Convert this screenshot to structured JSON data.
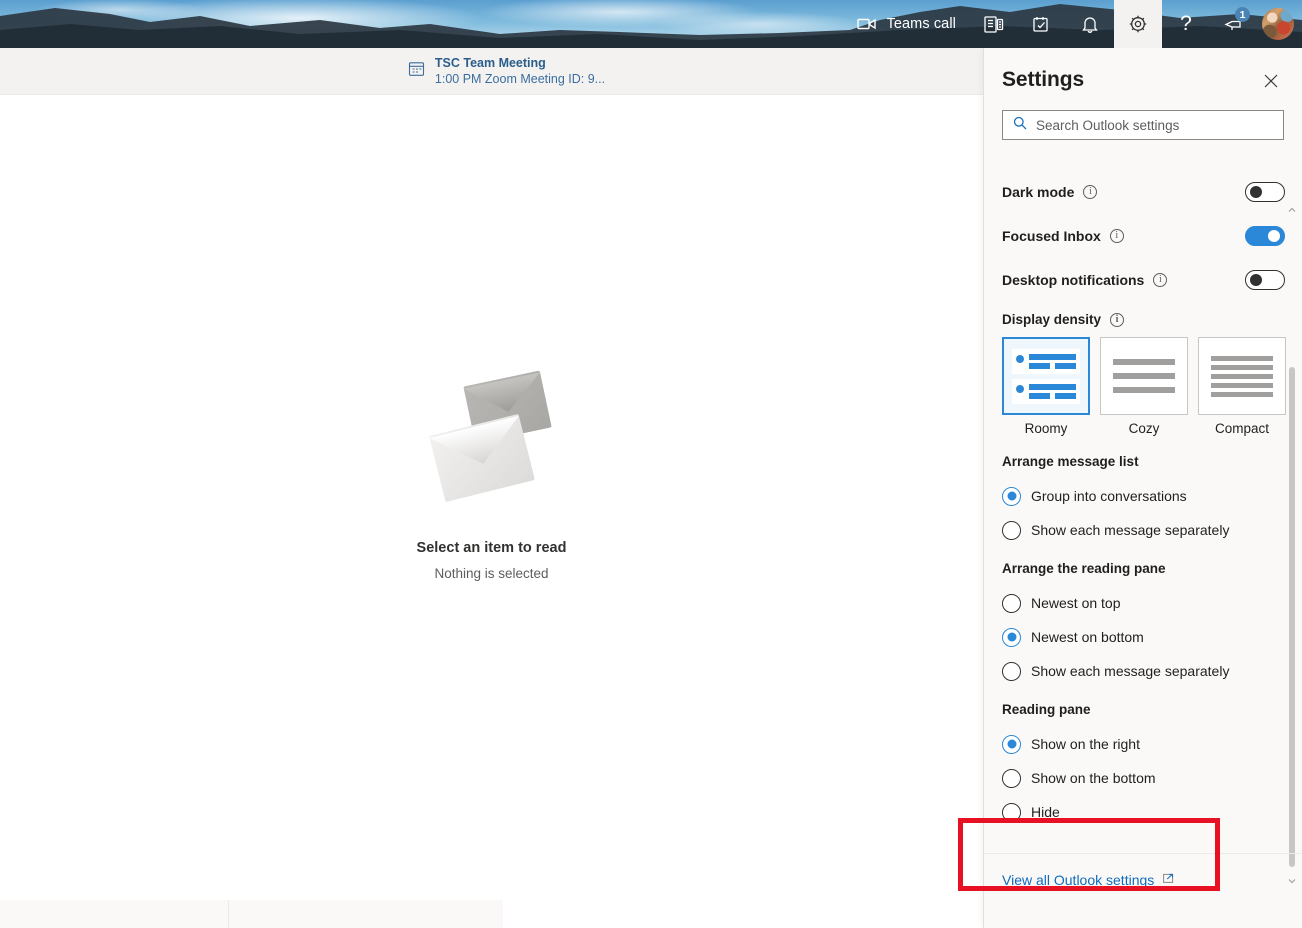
{
  "topbar": {
    "teams_call_label": "Teams call",
    "icons": [
      {
        "name": "video-camera-icon"
      },
      {
        "name": "office-apps-icon"
      },
      {
        "name": "tasks-icon"
      },
      {
        "name": "notifications-bell-icon"
      },
      {
        "name": "settings-gear-icon"
      },
      {
        "name": "help-question-icon"
      },
      {
        "name": "feedback-icon"
      },
      {
        "name": "account-avatar"
      }
    ],
    "feedback_badge": "1",
    "help_label": "?",
    "accent_color": "#4b88bb",
    "active_bg": "#f3f2f1"
  },
  "meeting_reminder": {
    "icon": "calendar-icon",
    "title": "TSC Team Meeting",
    "subtitle": "1:00 PM Zoom Meeting ID: 9...",
    "text_color": "#3b6e9e"
  },
  "reading_pane": {
    "empty_icon": "envelopes-icon",
    "empty_title": "Select an item to read",
    "empty_subtitle": "Nothing is selected"
  },
  "settings": {
    "title": "Settings",
    "close_icon": "close-icon",
    "search": {
      "icon": "search-icon",
      "placeholder": "Search Outlook settings",
      "value": ""
    },
    "toggles": [
      {
        "label": "Dark mode",
        "state": "off",
        "info_icon": "info-icon"
      },
      {
        "label": "Focused Inbox",
        "state": "on",
        "info_icon": "info-icon"
      },
      {
        "label": "Desktop notifications",
        "state": "off",
        "info_icon": "info-icon"
      }
    ],
    "display_density": {
      "heading": "Display density",
      "info_icon": "info-icon",
      "options": [
        {
          "label": "Roomy",
          "selected": true,
          "lines": 2
        },
        {
          "label": "Cozy",
          "selected": false,
          "lines": 3
        },
        {
          "label": "Compact",
          "selected": false,
          "lines": 5
        }
      ]
    },
    "arrange_message_list": {
      "heading": "Arrange message list",
      "options": [
        {
          "label": "Group into conversations",
          "selected": true
        },
        {
          "label": "Show each message separately",
          "selected": false
        }
      ]
    },
    "arrange_reading_pane": {
      "heading": "Arrange the reading pane",
      "options": [
        {
          "label": "Newest on top",
          "selected": false
        },
        {
          "label": "Newest on bottom",
          "selected": true
        },
        {
          "label": "Show each message separately",
          "selected": false
        }
      ]
    },
    "reading_pane_position": {
      "heading": "Reading pane",
      "options": [
        {
          "label": "Show on the right",
          "selected": true
        },
        {
          "label": "Show on the bottom",
          "selected": false
        },
        {
          "label": "Hide",
          "selected": false
        }
      ]
    },
    "footer": {
      "link_label": "View all Outlook settings",
      "link_icon": "open-in-new-window-icon",
      "link_color": "#0f6cbd"
    },
    "scrollbar": {
      "up_arrow_icon": "chevron-up-icon",
      "down_arrow_icon": "chevron-down-icon"
    }
  },
  "annotation": {
    "highlight_color": "#e81123"
  }
}
